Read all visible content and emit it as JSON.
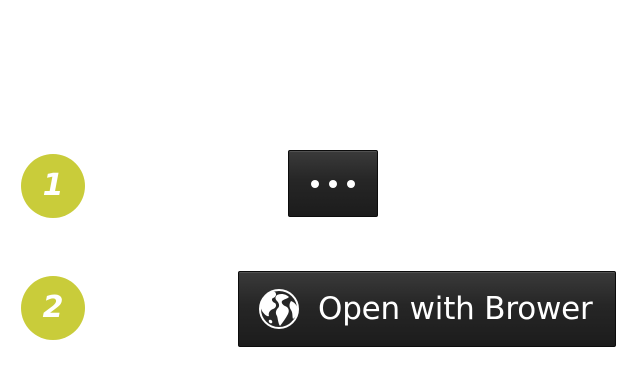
{
  "steps": [
    {
      "number": "1"
    },
    {
      "number": "2"
    }
  ],
  "more_button": {
    "icon": "more-horizontal-icon"
  },
  "open_button": {
    "icon": "globe-icon",
    "label": "Open with Brower"
  },
  "colors": {
    "badge": "#c9cc3a",
    "button_bg": "#262626",
    "button_text": "#ffffff"
  }
}
